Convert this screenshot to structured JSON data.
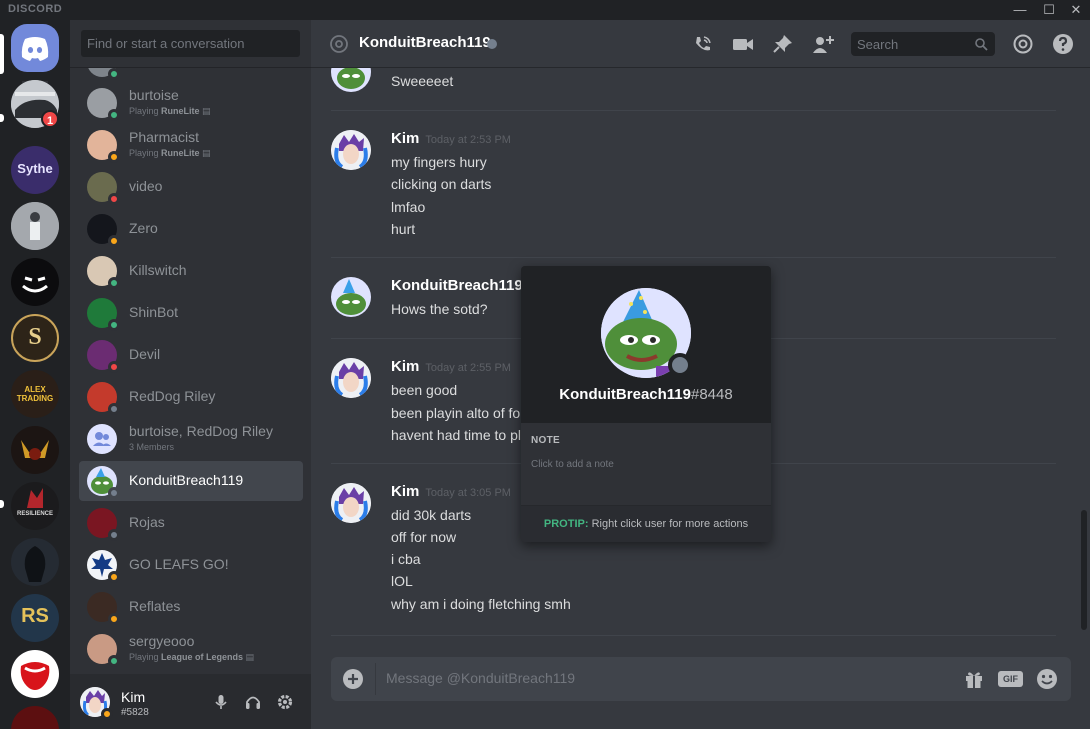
{
  "window": {
    "brand": "DISCORD",
    "minimize": "—",
    "maximize": "☐",
    "close": "✕"
  },
  "servers": [
    {
      "name": "home",
      "icon": "discord-logo-icon",
      "color": "#7289da"
    },
    {
      "name": "car-server",
      "badge": "1",
      "color": "#9aa0a6"
    },
    {
      "name": "sythe",
      "text": "Sythe",
      "color": "#3a2d6b"
    },
    {
      "name": "person-server",
      "color": "#8f9398"
    },
    {
      "name": "dark-face-server",
      "color": "#0c0c0e"
    },
    {
      "name": "s-server",
      "text": "S",
      "color": "#2d2418"
    },
    {
      "name": "alex-trading",
      "text": "ALEX TRADING",
      "color": "#2a1f18"
    },
    {
      "name": "viking-server",
      "color": "#1c1513"
    },
    {
      "name": "resilience-server",
      "text": "RESILIENCE",
      "color": "#1b1b1d"
    },
    {
      "name": "assassin-server",
      "color": "#252b33"
    },
    {
      "name": "rs-server",
      "text": "RS",
      "color": "#22364a"
    },
    {
      "name": "rolling-stones-server",
      "color": "#ffffff"
    },
    {
      "name": "red-server",
      "color": "#5c0f10"
    }
  ],
  "sidebar": {
    "search_placeholder": "Find or start a conversation",
    "dms": [
      {
        "name": "",
        "status": "online",
        "avatar": "#7e848b"
      },
      {
        "name": "burtoise",
        "status": "online",
        "sub": "Playing ",
        "sub_game": "RuneLite",
        "avatar": "#9a9ea3"
      },
      {
        "name": "Pharmacist",
        "status": "idle",
        "sub": "Playing ",
        "sub_game": "RuneLite",
        "avatar": "#e2b49a"
      },
      {
        "name": "video",
        "status": "dnd",
        "avatar": "#6a6b4e"
      },
      {
        "name": "Zero",
        "status": "idle",
        "avatar": "#14161c"
      },
      {
        "name": "Killswitch",
        "status": "online",
        "avatar": "#d9c8b4"
      },
      {
        "name": "ShinBot",
        "status": "online",
        "avatar": "#1f7a3a"
      },
      {
        "name": "Devil",
        "status": "dnd",
        "avatar": "#6b2c72"
      },
      {
        "name": "RedDog Riley",
        "status": "offline",
        "avatar": "#c43a2c"
      },
      {
        "name": "burtoise, RedDog Riley",
        "status": "",
        "sub": "3 Members",
        "avatar": "#dfe3ff",
        "group": true
      },
      {
        "name": "KonduitBreach119",
        "status": "offline",
        "avatar": "#4f8f3a",
        "active": true
      },
      {
        "name": "Rojas",
        "status": "offline",
        "avatar": "#7a1622"
      },
      {
        "name": "GO LEAFS GO!",
        "status": "idle",
        "avatar": "#f2f4f8"
      },
      {
        "name": "Reflates",
        "status": "idle",
        "avatar": "#3b2a23"
      },
      {
        "name": "sergyeooo",
        "status": "online",
        "sub": "Playing ",
        "sub_game": "League of Legends",
        "avatar": "#c99a84"
      }
    ],
    "user": {
      "name": "Kim",
      "tag": "#5828",
      "status": "idle"
    }
  },
  "chat": {
    "recipient": "KonduitBreach119",
    "header_search_placeholder": "Search",
    "composer_placeholder": "Message @KonduitBreach119",
    "gif_label": "GIF",
    "groups": [
      {
        "author": "",
        "timestamp": "",
        "lines": [
          "Sweeeeet"
        ],
        "avatar": "pepe"
      },
      {
        "author": "Kim",
        "timestamp": "Today at 2:53 PM",
        "lines": [
          "my fingers hury",
          "clicking on darts",
          "lmfao",
          "hurt"
        ],
        "avatar": "kim"
      },
      {
        "author": "KonduitBreach119",
        "timestamp": "",
        "lines": [
          "Hows the sotd?"
        ],
        "avatar": "pepe"
      },
      {
        "author": "Kim",
        "timestamp": "Today at 2:55 PM",
        "lines": [
          "been good",
          "been playin alto of fo",
          "havent had time to pl"
        ],
        "avatar": "kim"
      },
      {
        "author": "Kim",
        "timestamp": "Today at 3:05 PM",
        "lines": [
          "did 30k darts",
          "off for now",
          "i cba",
          "lOL",
          "why am i doing fletching smh"
        ],
        "avatar": "kim"
      }
    ]
  },
  "popout": {
    "username": "KonduitBreach119",
    "discriminator": "#8448",
    "note_label": "NOTE",
    "note_placeholder": "Click to add a note",
    "protip_label": "PROTIP:",
    "protip_text": " Right click user for more actions"
  },
  "colors": {
    "blurple": "#7289da",
    "online": "#43b581",
    "idle": "#faa61a",
    "dnd": "#f04747",
    "offline": "#747f8d"
  }
}
